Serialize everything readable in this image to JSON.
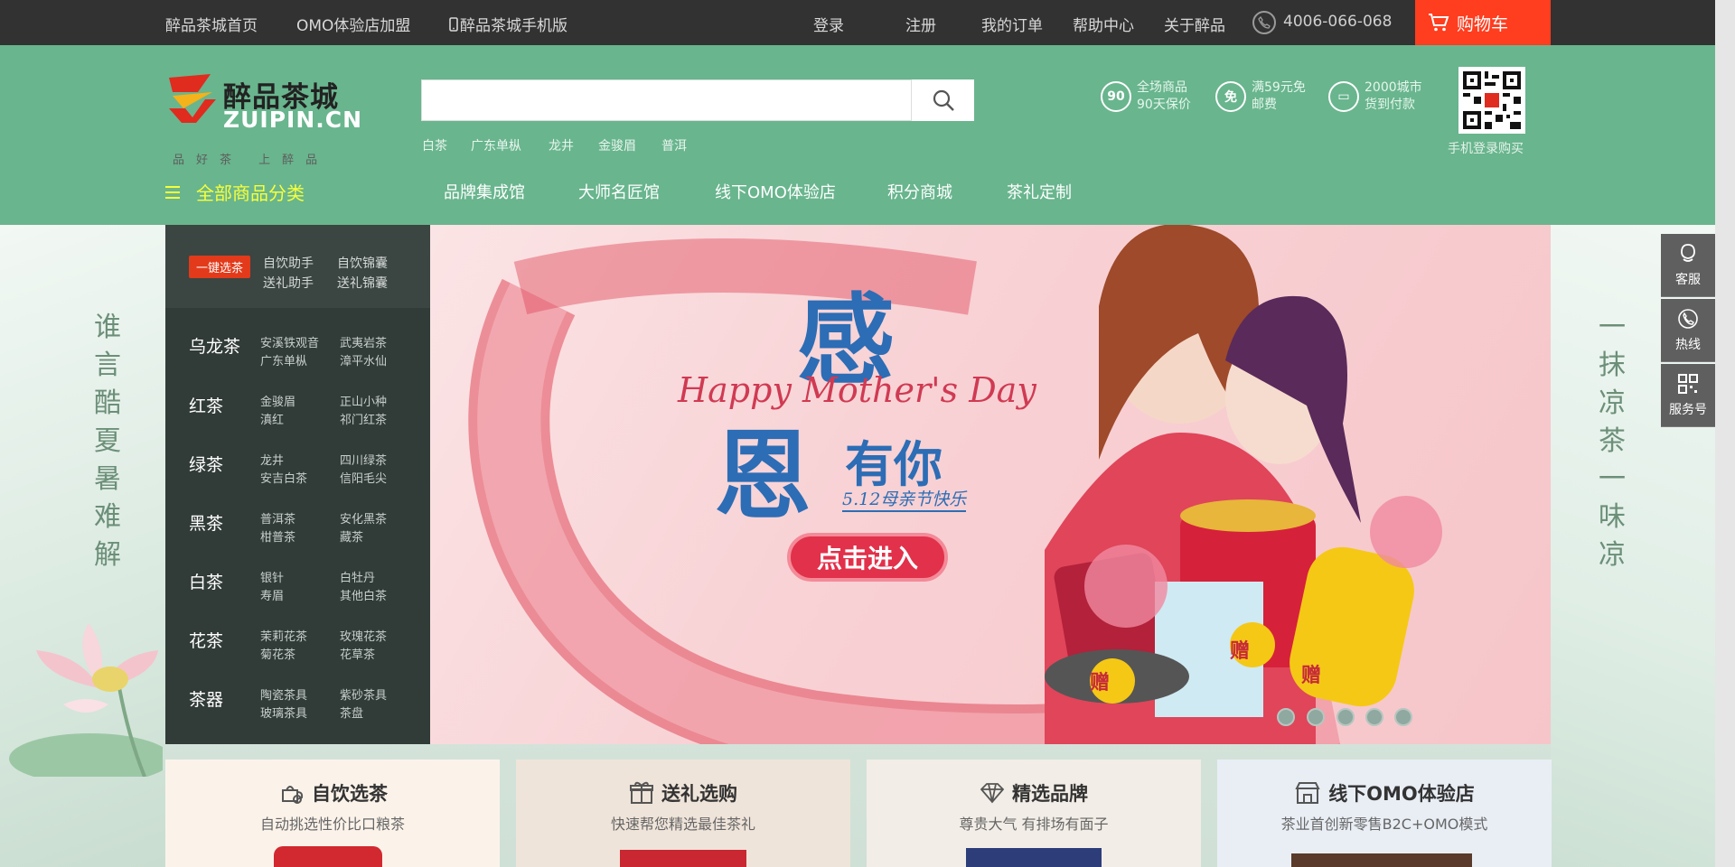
{
  "topbar": {
    "home": "醉品茶城首页",
    "omo_join": "OMO体验店加盟",
    "mobile": "醉品茶城手机版",
    "login": "登录",
    "register": "注册",
    "orders": "我的订单",
    "help": "帮助中心",
    "about": "关于醉品",
    "phone": "4006-066-068",
    "cart": "购物车"
  },
  "logo": {
    "cn": "醉品茶城",
    "en": "ZUIPIN.CN",
    "slogan": "品好茶 上醉品"
  },
  "search": {
    "placeholder": "",
    "hot": [
      "白茶",
      "广东单枞",
      "龙井",
      "金骏眉",
      "普洱"
    ]
  },
  "features": [
    {
      "icon": "shield-icon",
      "glyph": "90",
      "line1": "全场商品",
      "line2": "90天保价"
    },
    {
      "icon": "free-shipping-icon",
      "glyph": "免",
      "line1": "满59元免",
      "line2": "邮费"
    },
    {
      "icon": "cod-icon",
      "glyph": "▭",
      "line1": "2000城市",
      "line2": "货到付款"
    }
  ],
  "qr_caption": "手机登录购买",
  "nav": {
    "all_categories": "全部商品分类",
    "items": [
      "品牌集成馆",
      "大师名匠馆",
      "线下OMO体验店",
      "积分商城",
      "茶礼定制"
    ]
  },
  "category_panel": {
    "quick_tag": "一键选茶",
    "quick_links": [
      "自饮助手",
      "自饮锦囊",
      "送礼助手",
      "送礼锦囊"
    ],
    "categories": [
      {
        "name": "乌龙茶",
        "subs": [
          "安溪铁观音",
          "武夷岩茶",
          "广东单枞",
          "漳平水仙"
        ]
      },
      {
        "name": "红茶",
        "subs": [
          "金骏眉",
          "正山小种",
          "滇红",
          "祁门红茶"
        ]
      },
      {
        "name": "绿茶",
        "subs": [
          "龙井",
          "四川绿茶",
          "安吉白茶",
          "信阳毛尖"
        ]
      },
      {
        "name": "黑茶",
        "subs": [
          "普洱茶",
          "安化黑茶",
          "柑普茶",
          "藏茶"
        ]
      },
      {
        "name": "白茶",
        "subs": [
          "银针",
          "白牡丹",
          "寿眉",
          "其他白茶"
        ]
      },
      {
        "name": "花茶",
        "subs": [
          "茉莉花茶",
          "玫瑰花茶",
          "菊花茶",
          "花草茶"
        ]
      },
      {
        "name": "茶器",
        "subs": [
          "陶瓷茶具",
          "紫砂茶具",
          "玻璃茶具",
          "茶盘"
        ]
      }
    ]
  },
  "banner": {
    "big1": "感",
    "english": "Happy Mother's Day",
    "big2": "恩",
    "you": "有你",
    "date_line": "5.12母亲节快乐",
    "cta": "点击进入",
    "gift": "赠",
    "slide_count": 5
  },
  "side_poems": {
    "left": [
      "谁",
      "言",
      "酷",
      "夏",
      "暑",
      "难",
      "解"
    ],
    "right": [
      "一",
      "抹",
      "凉",
      "茶",
      "一",
      "味",
      "凉"
    ]
  },
  "service": [
    {
      "icon": "customer-service-icon",
      "label": "客服"
    },
    {
      "icon": "hotline-icon",
      "label": "热线"
    },
    {
      "icon": "qr-service-icon",
      "label": "服务号"
    }
  ],
  "cards": [
    {
      "title": "自饮选茶",
      "sub": "自动挑选性价比口粮茶",
      "icon": "teapot-icon",
      "bg": "#fbf3ea"
    },
    {
      "title": "送礼选购",
      "sub": "快速帮您精选最佳茶礼",
      "icon": "gift-icon",
      "bg": "#efe4d9"
    },
    {
      "title": "精选品牌",
      "sub": "尊贵大气 有排场有面子",
      "icon": "diamond-icon",
      "bg": "#f2ede6"
    },
    {
      "title": "线下OMO体验店",
      "sub": "茶业首创新零售B2C+OMO模式",
      "icon": "store-icon",
      "bg": "#e9eef5"
    }
  ],
  "colors": {
    "topbar": "#323232",
    "header_green": "#69b58e",
    "cart_red": "#ff3d1f",
    "all_cat_yellow": "#f7ff3a",
    "category_panel": "#313b38"
  }
}
